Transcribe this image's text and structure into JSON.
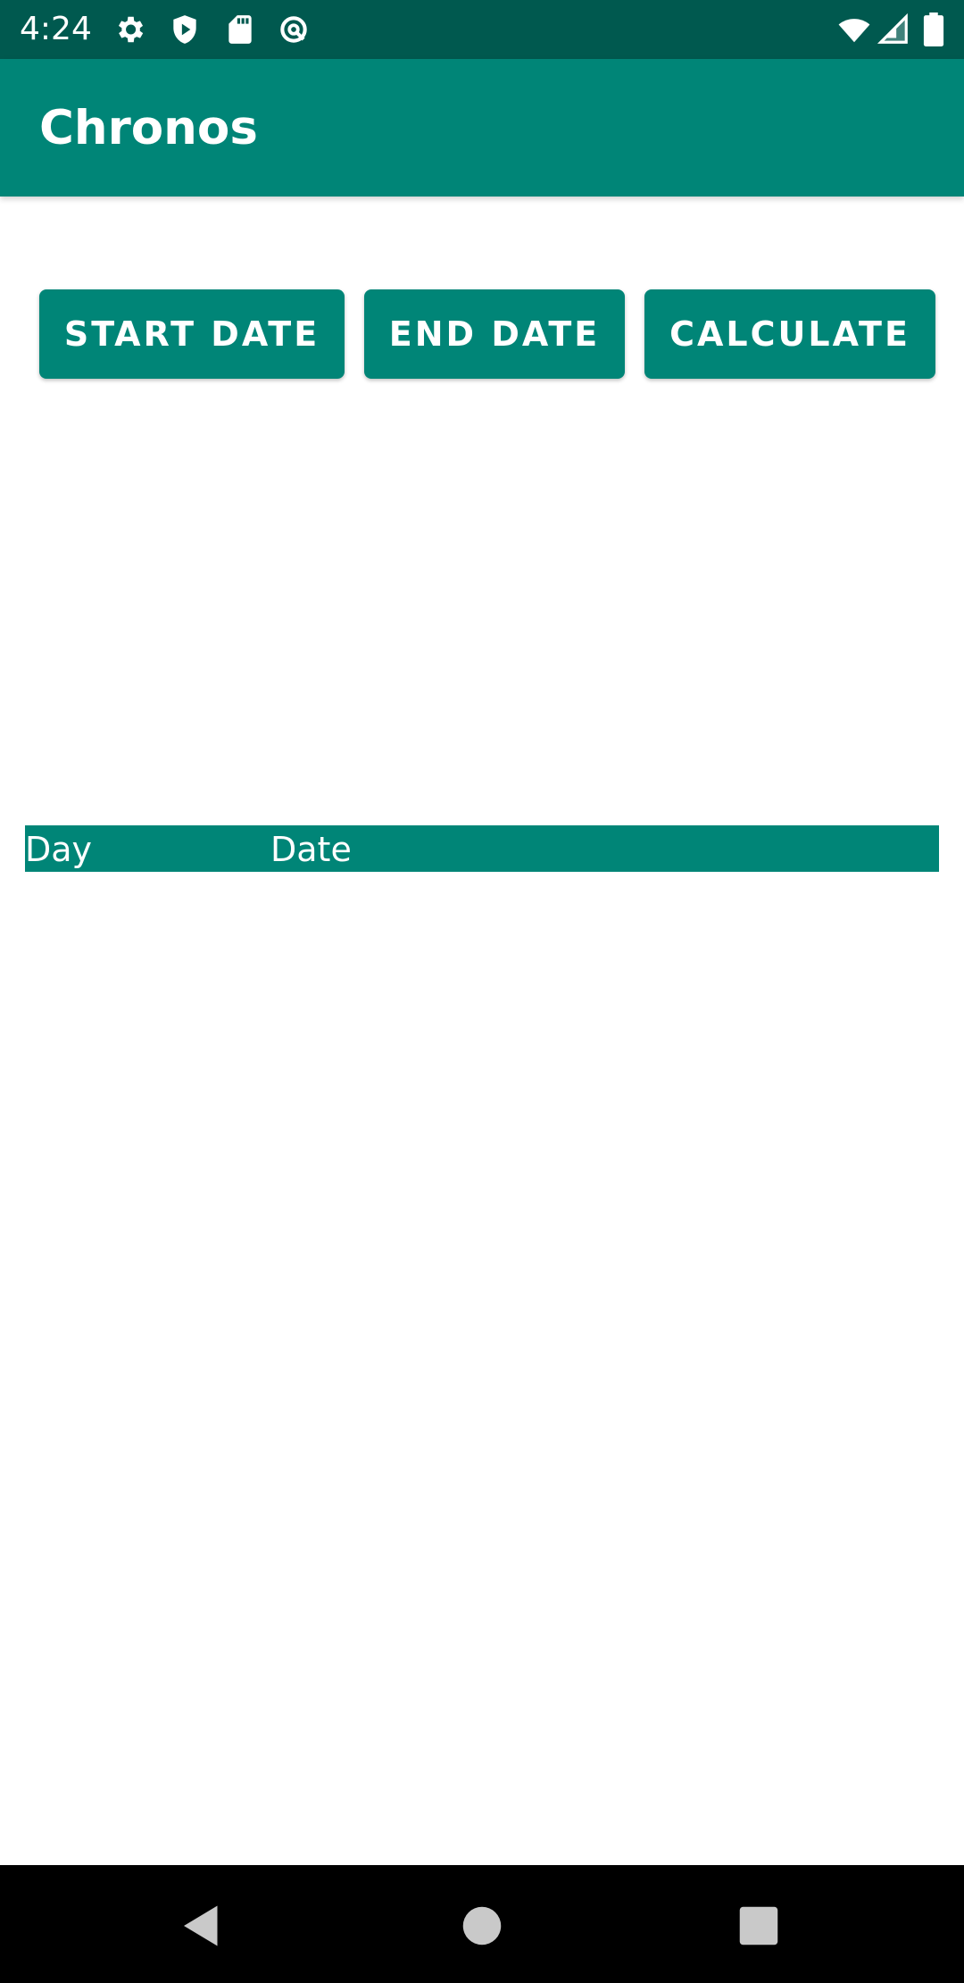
{
  "status_bar": {
    "time": "4:24",
    "icons": [
      "settings-icon",
      "shield-play-icon",
      "sd-card-icon",
      "sync-icon"
    ],
    "right_icons": [
      "wifi-icon",
      "signal-icon",
      "battery-icon"
    ]
  },
  "app_bar": {
    "title": "Chronos"
  },
  "buttons": {
    "start_date": "START DATE",
    "end_date": "END DATE",
    "calculate": "CALCULATE"
  },
  "table": {
    "headers": [
      "Day",
      "Date"
    ]
  },
  "nav_bar": {
    "icons": [
      "back-icon",
      "home-icon",
      "recents-icon"
    ]
  },
  "colors": {
    "primary": "#008577",
    "primary_dark": "#00594f",
    "on_primary": "#ffffff",
    "background": "#ffffff"
  }
}
